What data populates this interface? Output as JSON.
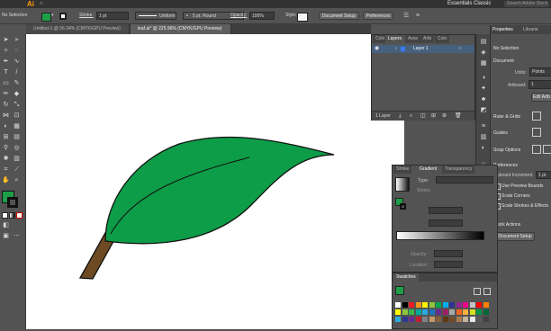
{
  "app": {
    "logo": "Ai",
    "workspace": "Essentials Classic",
    "search_placeholder": "Search Adobe Stock"
  },
  "control_bar": {
    "selection_label": "No Selection",
    "stroke_label": "Stroke:",
    "stroke_value": "1 pt",
    "profile_label": "Uniform",
    "brush_label": "5 pt. Round",
    "opacity_label": "Opacity:",
    "opacity_value": "100%",
    "style_label": "Style:",
    "document_setup": "Document Setup",
    "preferences": "Preferences",
    "fill_color": "#1e9e48"
  },
  "tabs": [
    {
      "label": "Untitled-1 @ 56.34% (CMYK/GPU Preview)"
    },
    {
      "label": "leaf.ai* @ 225.96% (CMYK/GPU Preview)"
    }
  ],
  "layers_panel": {
    "tabs": [
      "Colo",
      "Layers",
      "Asse",
      "Artb",
      "Colo"
    ],
    "layer_name": "Layer 1",
    "footer": "1 Layer"
  },
  "properties_panel": {
    "title": "Properties",
    "libraries_tab": "Librarie",
    "no_selection": "No Selection",
    "document_heading": "Document",
    "units_label": "Units:",
    "units_value": "Points",
    "artboard_label": "Artboard:",
    "artboard_value": "1",
    "edit_artboards": "Edit Artb",
    "rulers_grids": "Ruler & Grids",
    "guides": "Guides",
    "snap_options": "Snap Options",
    "preferences": "Preferences",
    "keyboard_increment_label": "Keyboard Increment:",
    "keyboard_increment_value": "1 pt",
    "use_preview_bounds": "Use Preview Bounds",
    "scale_corners": "Scale Corners",
    "scale_strokes": "Scale Strokes & Effects",
    "quick_actions": "Quick Actions",
    "document_setup": "Document Setup"
  },
  "gradient_panel": {
    "tabs": [
      "Stroke",
      "Gradient",
      "Transparency"
    ],
    "type_label": "Type:",
    "stroke_label": "Stroke:",
    "opacity_label": "Opacity:",
    "location_label": "Location:"
  },
  "swatches_panel": {
    "title": "Swatches",
    "colors": [
      "#ffffff",
      "#000000",
      "#ed1c24",
      "#f7941d",
      "#fff200",
      "#8dc63f",
      "#00a651",
      "#00aeef",
      "#2e3192",
      "#92278f",
      "#ec008c",
      "#c4c4c4",
      "#ff0000",
      "#ff7f00",
      "#ffff00",
      "#8cc63f",
      "#39b54a",
      "#00a99d",
      "#27aae1",
      "#1c75bc",
      "#662d91",
      "#9e1f63",
      "#a7a9ac",
      "#f26522",
      "#fbb040",
      "#d7df23",
      "#009444",
      "#006838",
      "#29abe2",
      "#2b3990",
      "#652d90",
      "#be1e2d",
      "#808285",
      "#c49a6c",
      "#8b5e3c",
      "#603913",
      "#754c29",
      "#a97c50",
      "#c2b59b",
      "#e6e7e8",
      "#58595b",
      "#414042"
    ]
  },
  "leaf": {
    "leaf_fill": "#0d9c47",
    "stem_fill": "#6d4a22",
    "outline": "#111111"
  }
}
